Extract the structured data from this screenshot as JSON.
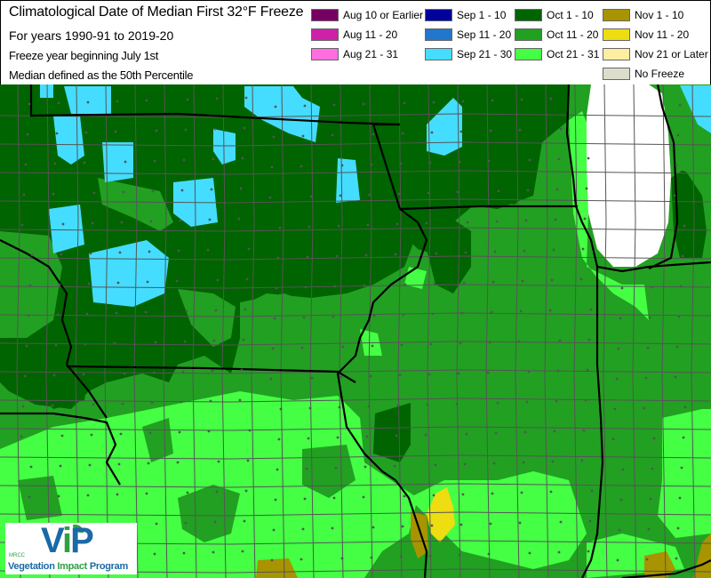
{
  "header": {
    "title": "Climatological Date of Median First 32°F Freeze",
    "subtitle": "For years 1990-91 to 2019-20",
    "note1": "Freeze year beginning July 1st",
    "note2": "Median defined as the 50th Percentile"
  },
  "legend": [
    {
      "label": "Aug 10 or Earlier",
      "color": "#760062"
    },
    {
      "label": "Aug 11 - 20",
      "color": "#cd22a8"
    },
    {
      "label": "Aug 21 - 31",
      "color": "#ff6ee0"
    },
    {
      "label": "Sep 1 - 10",
      "color": "#00009a"
    },
    {
      "label": "Sep 11 - 20",
      "color": "#2277cc"
    },
    {
      "label": "Sep 21 - 30",
      "color": "#44ddff"
    },
    {
      "label": "Oct 1 - 10",
      "color": "#006400"
    },
    {
      "label": "Oct 11 - 20",
      "color": "#22a022"
    },
    {
      "label": "Oct 21 - 31",
      "color": "#44ff44"
    },
    {
      "label": "Nov 1 - 10",
      "color": "#a89400"
    },
    {
      "label": "Nov 11 - 20",
      "color": "#eedd11"
    },
    {
      "label": "Nov 21 or Later",
      "color": "#ffeea0"
    },
    {
      "label": "No Freeze",
      "color": "#ddddcc"
    }
  ],
  "logo": {
    "org": "MRCC",
    "name_prefix": "V",
    "name_i": "i",
    "name_suffix": "P",
    "program_word1": "Vegetation",
    "program_word2": "Impact",
    "program_word3": "Program"
  },
  "map": {
    "water_color": "#ffffff",
    "border_color": "#000000",
    "county_color": "#555555"
  }
}
